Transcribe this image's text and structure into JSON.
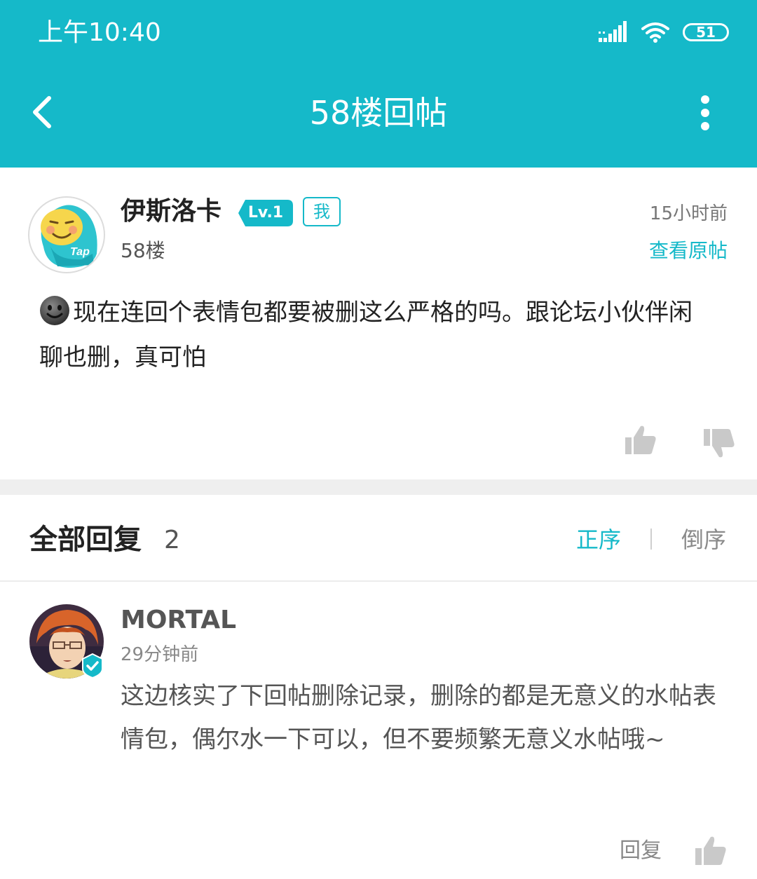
{
  "status_bar": {
    "time": "上午10:40",
    "battery": "51"
  },
  "header": {
    "title": "58楼回帖"
  },
  "post": {
    "author": "伊斯洛卡",
    "level": "Lv.1",
    "me_tag": "我",
    "floor": "58楼",
    "time_ago": "15小时前",
    "view_origin": "查看原帖",
    "avatar_text": "Tap",
    "content": "现在连回个表情包都要被删这么严格的吗。跟论坛小伙伴闲聊也删，真可怕"
  },
  "replies": {
    "title": "全部回复",
    "count": "2",
    "sort_asc": "正序",
    "sort_desc": "倒序",
    "items": [
      {
        "name": "MORTAL",
        "time": "29分钟前",
        "text": "这边核实了下回帖删除记录，删除的都是无意义的水帖表情包，偶尔水一下可以，但不要频繁无意义水帖哦~",
        "reply_label": "回复"
      }
    ]
  },
  "colors": {
    "accent": "#15b9c9",
    "text": "#222222",
    "muted": "#888888"
  },
  "icons": [
    "back-arrow-icon",
    "more-vertical-icon",
    "signal-icon",
    "wifi-icon",
    "battery-icon",
    "thumbs-up-icon",
    "thumbs-down-icon",
    "verified-icon",
    "smiley-icon"
  ]
}
